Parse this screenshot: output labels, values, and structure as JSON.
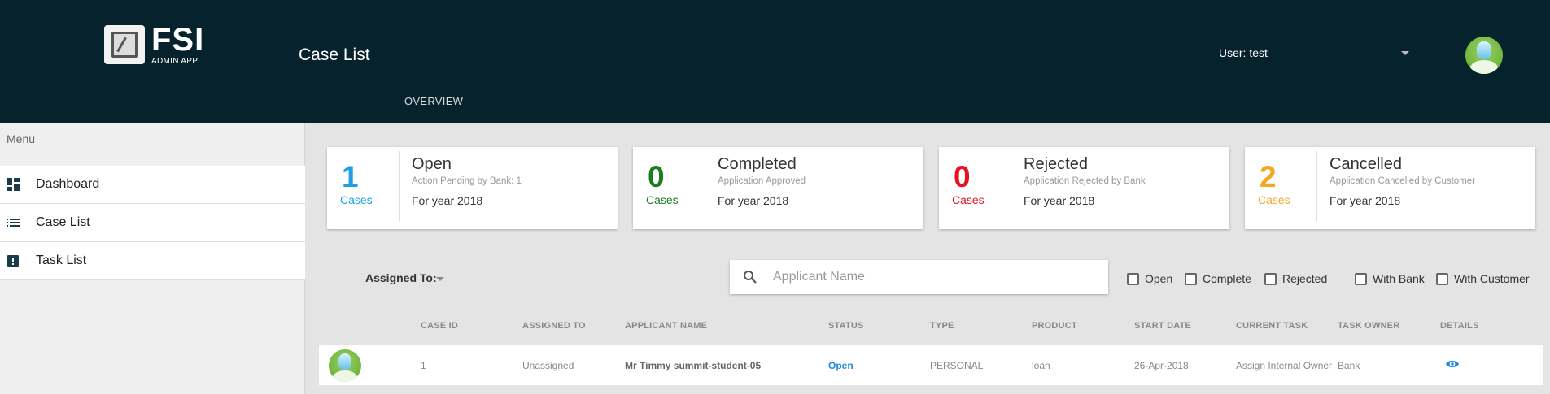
{
  "header": {
    "logo_text": "FSI",
    "logo_sub": "ADMIN APP",
    "title": "Case List",
    "user_label": "User: test",
    "tab": "OVERVIEW"
  },
  "sidebar": {
    "menu_label": "Menu",
    "items": [
      {
        "label": "Dashboard",
        "icon": "dashboard-icon"
      },
      {
        "label": "Case List",
        "icon": "list-icon"
      },
      {
        "label": "Task List",
        "icon": "clipboard-alert-icon"
      }
    ]
  },
  "cards": [
    {
      "count": "1",
      "unit": "Cases",
      "title": "Open",
      "subtitle": "Action Pending by Bank: 1",
      "year": "For year 2018",
      "color": "#1e9ee6"
    },
    {
      "count": "0",
      "unit": "Cases",
      "title": "Completed",
      "subtitle": "Application Approved",
      "year": "For year 2018",
      "color": "#1b7d1e"
    },
    {
      "count": "0",
      "unit": "Cases",
      "title": "Rejected",
      "subtitle": "Application Rejected by Bank",
      "year": "For year 2018",
      "color": "#e8121e"
    },
    {
      "count": "2",
      "unit": "Cases",
      "title": "Cancelled",
      "subtitle": "Application Cancelled by Customer",
      "year": "For year 2018",
      "color": "#f5a623"
    }
  ],
  "filters": {
    "assigned_label": "Assigned To:",
    "search_placeholder": "Applicant Name",
    "search_value": "",
    "checkboxes": [
      {
        "label": "Open",
        "checked": false
      },
      {
        "label": "Complete",
        "checked": false
      },
      {
        "label": "Rejected",
        "checked": false
      },
      {
        "label": "With Bank",
        "checked": false
      },
      {
        "label": "With Customer",
        "checked": false
      }
    ]
  },
  "table": {
    "columns": [
      "CASE ID",
      "ASSIGNED TO",
      "APPLICANT NAME",
      "STATUS",
      "TYPE",
      "PRODUCT",
      "START DATE",
      "CURRENT TASK",
      "TASK OWNER",
      "DETAILS"
    ],
    "rows": [
      {
        "case_id": "1",
        "assigned_to": "Unassigned",
        "applicant_name": "Mr Timmy summit-student-05",
        "status": "Open",
        "type": "PERSONAL",
        "product": "loan",
        "start_date": "26-Apr-2018",
        "current_task": "Assign Internal Owner",
        "task_owner": "Bank",
        "details_icon": "eye-icon"
      }
    ]
  },
  "colors": {
    "header_bg": "#06222d",
    "accent": "#1e88e5"
  }
}
